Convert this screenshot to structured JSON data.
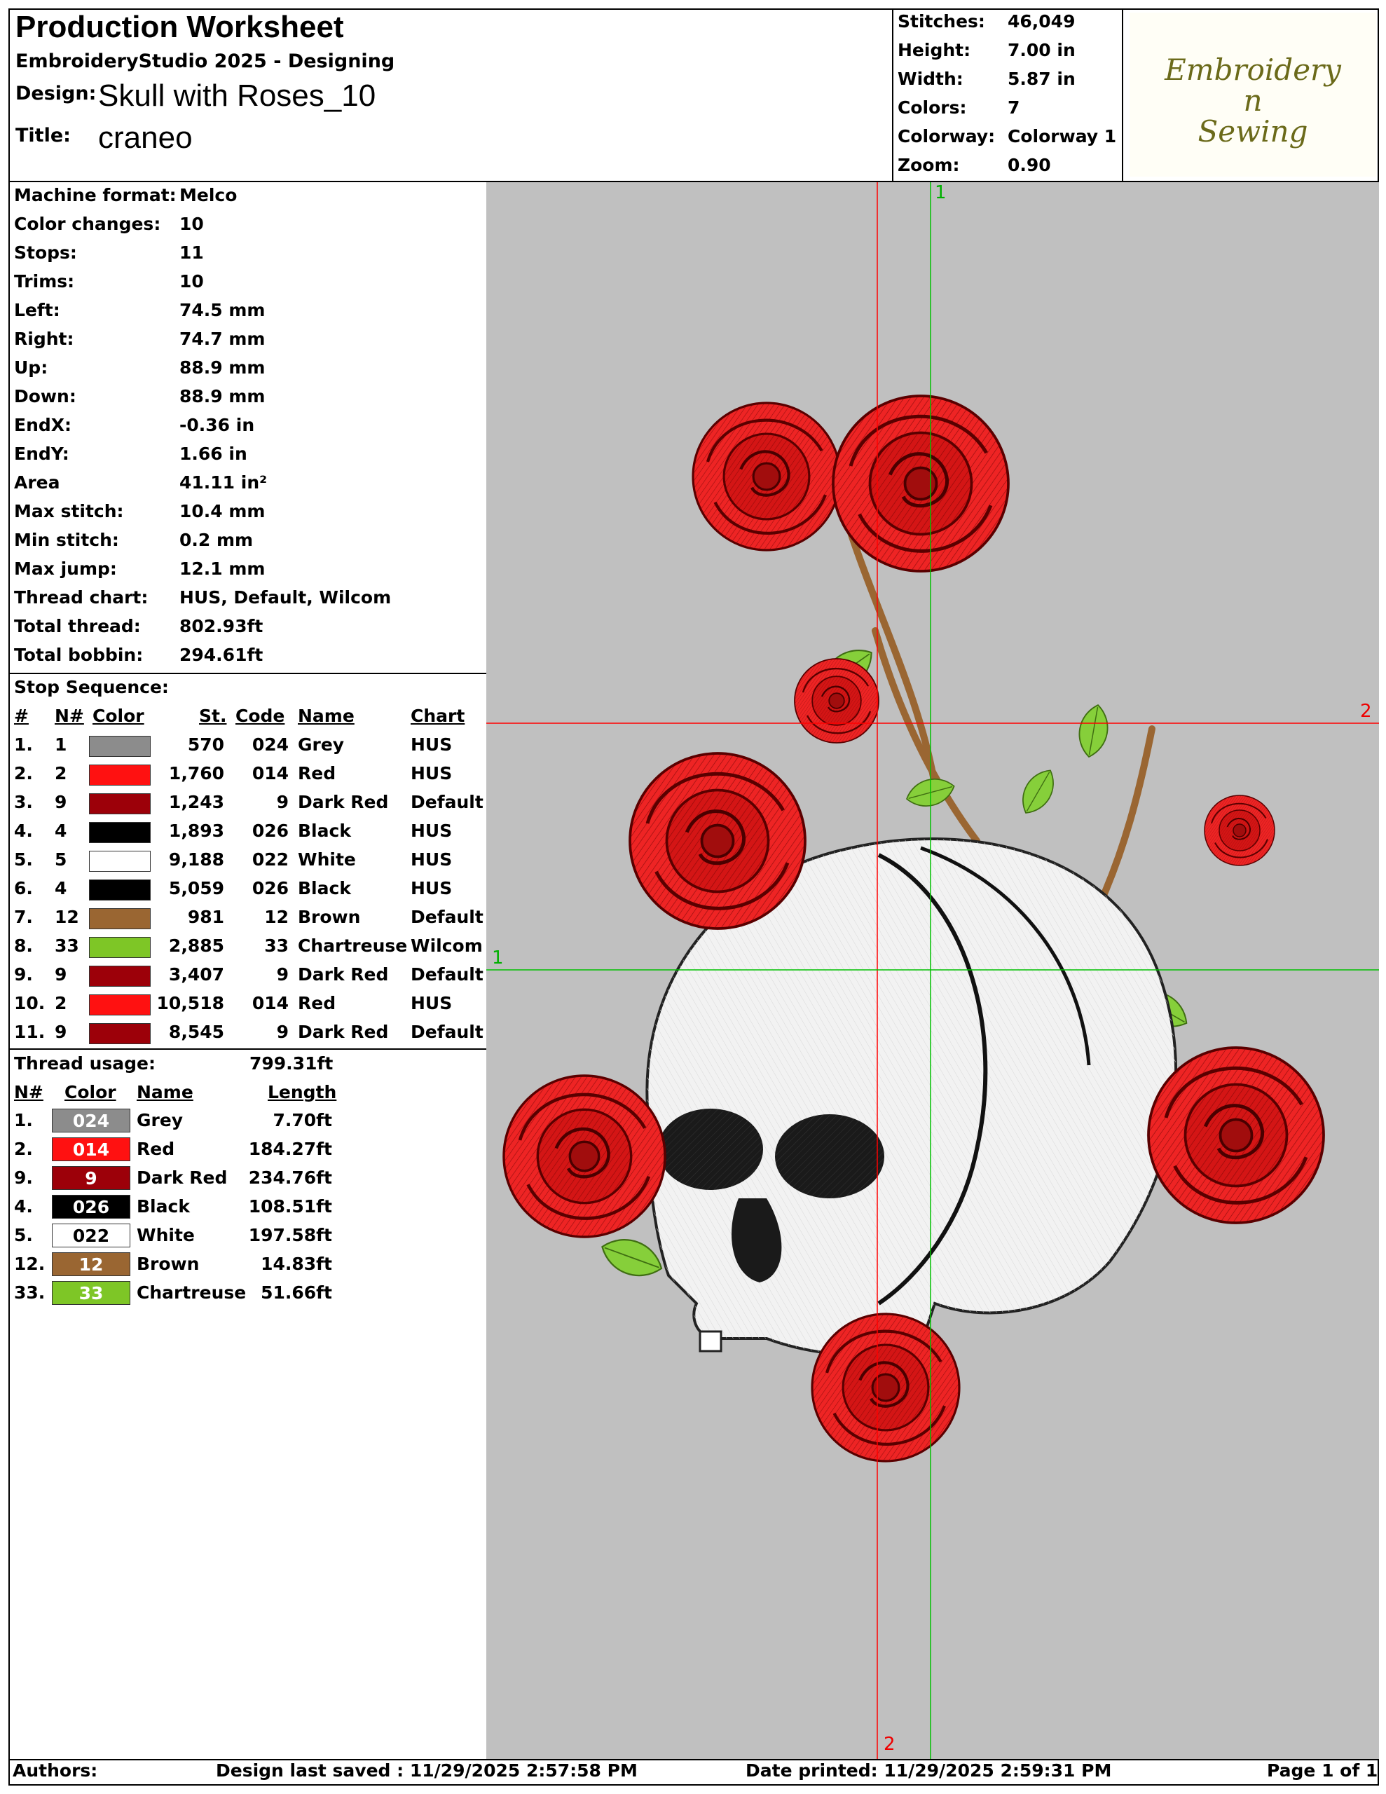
{
  "header": {
    "title": "Production Worksheet",
    "software": "EmbroideryStudio 2025 - Designing",
    "design_label": "Design:",
    "design_value": "Skull with Roses_10",
    "title_label": "Title:",
    "title_value": "craneo"
  },
  "stats": [
    {
      "label": "Stitches:",
      "value": "46,049"
    },
    {
      "label": "Height:",
      "value": "7.00 in"
    },
    {
      "label": "Width:",
      "value": "5.87 in"
    },
    {
      "label": "Colors:",
      "value": "7"
    },
    {
      "label": "Colorway:",
      "value": "Colorway 1"
    },
    {
      "label": "Zoom:",
      "value": "0.90"
    }
  ],
  "logo": {
    "line1": "Embroidery",
    "line2": "n",
    "line3": "Sewing",
    "color": "#6b6a1a"
  },
  "machine_info": [
    {
      "label": "Machine format:",
      "value": "Melco"
    },
    {
      "label": "Color changes:",
      "value": "10"
    },
    {
      "label": "Stops:",
      "value": "11"
    },
    {
      "label": "Trims:",
      "value": "10"
    },
    {
      "label": "Left:",
      "value": "74.5 mm"
    },
    {
      "label": "Right:",
      "value": "74.7 mm"
    },
    {
      "label": "Up:",
      "value": "88.9 mm"
    },
    {
      "label": "Down:",
      "value": "88.9 mm"
    },
    {
      "label": "EndX:",
      "value": "-0.36 in"
    },
    {
      "label": "EndY:",
      "value": "1.66 in"
    },
    {
      "label": "Area",
      "value": " 41.11 in²"
    },
    {
      "label": "Max stitch:",
      "value": "10.4 mm"
    },
    {
      "label": "Min stitch:",
      "value": "0.2 mm"
    },
    {
      "label": "Max jump:",
      "value": "12.1 mm"
    },
    {
      "label": "Thread chart:",
      "value": "HUS, Default, Wilcom"
    },
    {
      "label": "Total thread:",
      "value": "802.93ft"
    },
    {
      "label": "Total bobbin:",
      "value": "294.61ft"
    }
  ],
  "stop_sequence": {
    "title": "Stop Sequence:",
    "headers": {
      "num": "#",
      "n": "N#",
      "color": "Color",
      "st": "St.",
      "code": "Code",
      "name": "Name",
      "chart": "Chart"
    },
    "rows": [
      {
        "num": "1.",
        "n": "1",
        "color": "#8c8c8c",
        "st": "570",
        "code": "024",
        "name": "Grey",
        "chart": "HUS"
      },
      {
        "num": "2.",
        "n": "2",
        "color": "#ff1111",
        "st": "1,760",
        "code": "014",
        "name": "Red",
        "chart": "HUS"
      },
      {
        "num": "3.",
        "n": "9",
        "color": "#9c0009",
        "st": "1,243",
        "code": "9",
        "name": "Dark Red",
        "chart": "Default"
      },
      {
        "num": "4.",
        "n": "4",
        "color": "#000000",
        "st": "1,893",
        "code": "026",
        "name": "Black",
        "chart": "HUS"
      },
      {
        "num": "5.",
        "n": "5",
        "color": "#ffffff",
        "st": "9,188",
        "code": "022",
        "name": "White",
        "chart": "HUS"
      },
      {
        "num": "6.",
        "n": "4",
        "color": "#000000",
        "st": "5,059",
        "code": "026",
        "name": "Black",
        "chart": "HUS"
      },
      {
        "num": "7.",
        "n": "12",
        "color": "#9a6632",
        "st": "981",
        "code": "12",
        "name": "Brown",
        "chart": "Default"
      },
      {
        "num": "8.",
        "n": "33",
        "color": "#7ec626",
        "st": "2,885",
        "code": "33",
        "name": "Chartreuse",
        "chart": "Wilcom"
      },
      {
        "num": "9.",
        "n": "9",
        "color": "#9c0009",
        "st": "3,407",
        "code": "9",
        "name": "Dark Red",
        "chart": "Default"
      },
      {
        "num": "10.",
        "n": "2",
        "color": "#ff1111",
        "st": "10,518",
        "code": "014",
        "name": "Red",
        "chart": "HUS"
      },
      {
        "num": "11.",
        "n": "9",
        "color": "#9c0009",
        "st": "8,545",
        "code": "9",
        "name": "Dark Red",
        "chart": "Default"
      }
    ]
  },
  "thread_usage": {
    "title": "Thread usage:",
    "total": "799.31ft",
    "headers": {
      "n": "N#",
      "color": "Color",
      "name": "Name",
      "length": "Length"
    },
    "rows": [
      {
        "n": "1.",
        "code": "024",
        "color": "#8c8c8c",
        "name": "Grey",
        "length": "7.70ft"
      },
      {
        "n": "2.",
        "code": "014",
        "color": "#ff1111",
        "name": "Red",
        "length": "184.27ft"
      },
      {
        "n": "9.",
        "code": "9",
        "color": "#9c0009",
        "name": "Dark Red",
        "length": "234.76ft"
      },
      {
        "n": "4.",
        "code": "026",
        "color": "#000000",
        "name": "Black",
        "length": "108.51ft"
      },
      {
        "n": "5.",
        "code": "022",
        "color": "#ffffff",
        "name": "White",
        "length": "197.58ft"
      },
      {
        "n": "12.",
        "code": "12",
        "color": "#9a6632",
        "name": "Brown",
        "length": "14.83ft"
      },
      {
        "n": "33.",
        "code": "33",
        "color": "#7ec626",
        "name": "Chartreuse",
        "length": "51.66ft"
      }
    ]
  },
  "design_view": {
    "background": "#c0c0c0",
    "red_markers": [
      "2",
      "2"
    ],
    "green_markers": [
      "1",
      "1"
    ]
  },
  "footer": {
    "authors": "Authors:",
    "saved": "Design last saved : 11/29/2025 2:57:58 PM",
    "printed": "Date printed: 11/29/2025 2:59:31 PM",
    "page": "Page 1 of 1"
  }
}
